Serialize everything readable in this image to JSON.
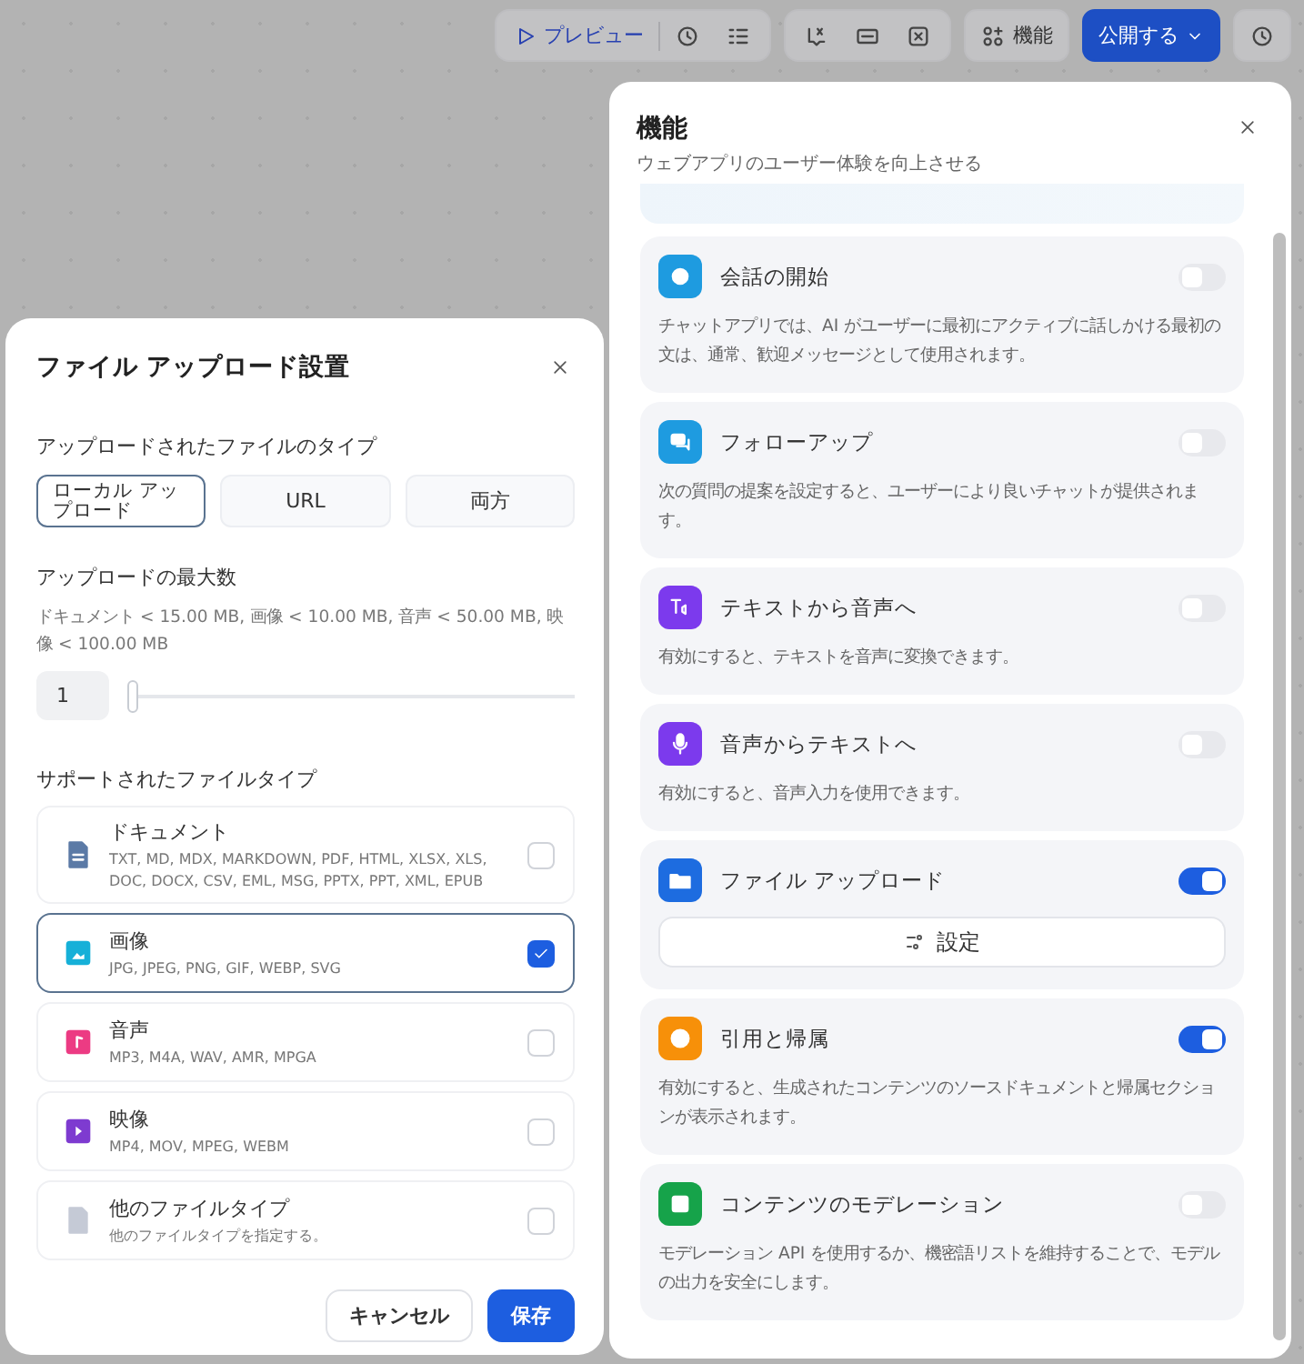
{
  "toolbar": {
    "preview": "プレビュー",
    "features": "機能",
    "publish": "公開する"
  },
  "features_panel": {
    "title": "機能",
    "subtitle": "ウェブアプリのユーザー体験を向上させる",
    "items": [
      {
        "kind": "description",
        "color": "#1e9be0",
        "title": "会話の開始",
        "on": false,
        "description": "チャットアプリでは、AI がユーザーに最初にアクティブに話しかける最初の文は、通常、歓迎メッセージとして使用されます。"
      },
      {
        "kind": "description",
        "color": "#1e9be0",
        "title": "フォローアップ",
        "on": false,
        "description": "次の質問の提案を設定すると、ユーザーにより良いチャットが提供されます。"
      },
      {
        "kind": "description",
        "color": "#7c3aed",
        "title": "テキストから音声へ",
        "on": false,
        "description": "有効にすると、テキストを音声に変換できます。"
      },
      {
        "kind": "description",
        "color": "#7c3aed",
        "title": "音声からテキストへ",
        "on": false,
        "description": "有効にすると、音声入力を使用できます。"
      },
      {
        "kind": "settings",
        "color": "#1d6ce0",
        "title": "ファイル アップロード",
        "on": true,
        "button": "設定"
      },
      {
        "kind": "description",
        "color": "#f79009",
        "title": "引用と帰属",
        "on": true,
        "description": "有効にすると、生成されたコンテンツのソースドキュメントと帰属セクションが表示されます。"
      },
      {
        "kind": "description",
        "color": "#16a34a",
        "title": "コンテンツのモデレーション",
        "on": false,
        "description": "モデレーション API を使用するか、機密語リストを維持することで、モデルの出力を安全にします。"
      }
    ]
  },
  "upload_dialog": {
    "title": "ファイル アップロード設置",
    "source_label": "アップロードされたファイルのタイプ",
    "sources": [
      {
        "label": "ローカル アップロード",
        "selected": true
      },
      {
        "label": "URL",
        "selected": false
      },
      {
        "label": "両方",
        "selected": false
      }
    ],
    "max_label": "アップロードの最大数",
    "max_hint": "ドキュメント < 15.00 MB, 画像 < 10.00 MB, 音声 < 50.00 MB, 映像 < 100.00 MB",
    "max_value": "1",
    "max_slider": {
      "level": 0
    },
    "types_label": "サポートされたファイルタイプ",
    "types": [
      {
        "color": "#5b7aa6",
        "name": "ドキュメント",
        "formats": "TXT, MD, MDX, MARKDOWN, PDF, HTML, XLSX, XLS, DOC, DOCX, CSV, EML, MSG, PPTX, PPT, XML, EPUB",
        "checked": false
      },
      {
        "color": "#16b0d8",
        "name": "画像",
        "formats": "JPG, JPEG, PNG, GIF, WEBP, SVG",
        "checked": true
      },
      {
        "color": "#ec3b83",
        "name": "音声",
        "formats": "MP3, M4A, WAV, AMR, MPGA",
        "checked": false
      },
      {
        "color": "#7e3bd0",
        "name": "映像",
        "formats": "MP4, MOV, MPEG, WEBM",
        "checked": false
      },
      {
        "color": "#c5cad6",
        "name": "他のファイルタイプ",
        "formats": "他のファイルタイプを指定する。",
        "checked": false
      }
    ],
    "cancel": "キャンセル",
    "save": "保存"
  }
}
